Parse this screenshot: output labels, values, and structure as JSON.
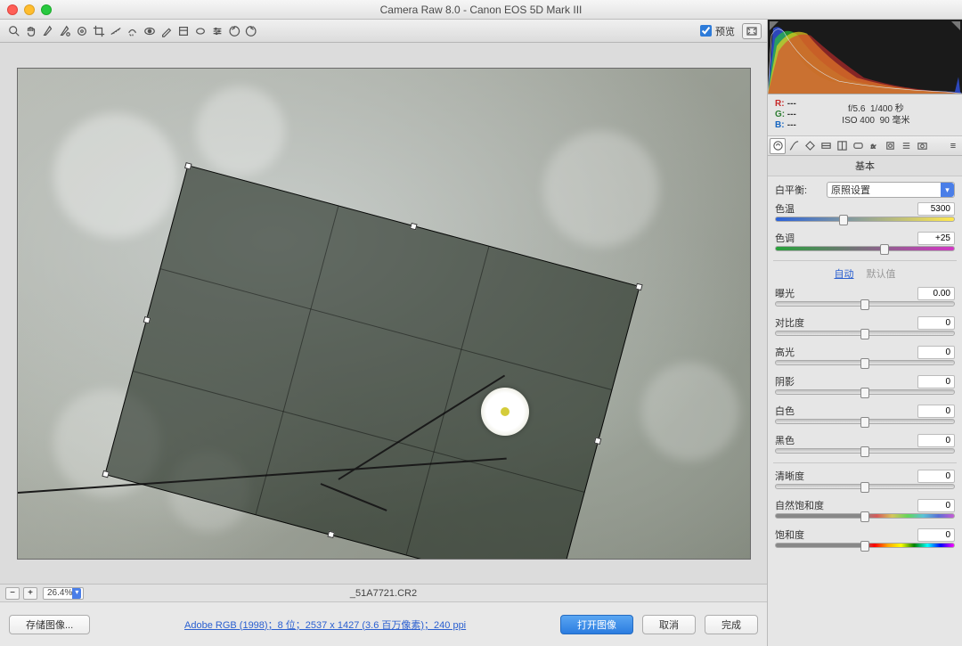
{
  "titlebar": {
    "title": "Camera Raw 8.0 -  Canon EOS 5D Mark III"
  },
  "toolbar": {
    "preview_label": "预览",
    "preview_checked": true
  },
  "status": {
    "zoom": "26.4%",
    "filename": "_51A7721.CR2"
  },
  "footer": {
    "save_image": "存储图像...",
    "info_link": "Adobe RGB (1998)；8 位；2537 x 1427 (3.6 百万像素)；240 ppi",
    "open_image": "打开图像",
    "cancel": "取消",
    "done": "完成"
  },
  "info": {
    "r": "---",
    "g": "---",
    "b": "---",
    "aperture": "f/5.6",
    "shutter": "1/400 秒",
    "iso": "ISO 400",
    "focal": "90 毫米"
  },
  "panel": {
    "title": "基本",
    "wb_label": "白平衡:",
    "wb_value": "原照设置",
    "auto_label": "自动",
    "default_label": "默认值",
    "sliders": {
      "temp": {
        "label": "色温",
        "value": "5300",
        "pos": 38
      },
      "tint": {
        "label": "色调",
        "value": "+25",
        "pos": 61
      },
      "exposure": {
        "label": "曝光",
        "value": "0.00",
        "pos": 50
      },
      "contrast": {
        "label": "对比度",
        "value": "0",
        "pos": 50
      },
      "highlights": {
        "label": "高光",
        "value": "0",
        "pos": 50
      },
      "shadows": {
        "label": "阴影",
        "value": "0",
        "pos": 50
      },
      "whites": {
        "label": "白色",
        "value": "0",
        "pos": 50
      },
      "blacks": {
        "label": "黑色",
        "value": "0",
        "pos": 50
      },
      "clarity": {
        "label": "清晰度",
        "value": "0",
        "pos": 50
      },
      "vibrance": {
        "label": "自然饱和度",
        "value": "0",
        "pos": 50
      },
      "saturation": {
        "label": "饱和度",
        "value": "0",
        "pos": 50
      }
    }
  }
}
